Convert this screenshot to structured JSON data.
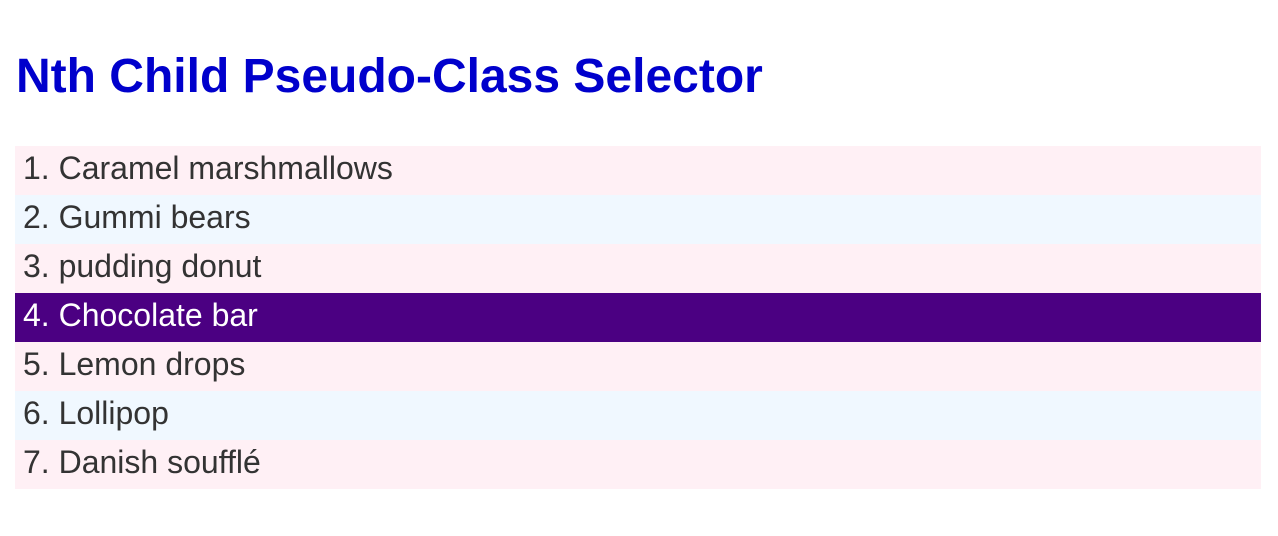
{
  "page": {
    "title": "Nth Child Pseudo-Class Selector"
  },
  "list": {
    "items": [
      {
        "number": "1.",
        "label": "Caramel marshmallows"
      },
      {
        "number": "2.",
        "label": "Gummi bears"
      },
      {
        "number": "3.",
        "label": "pudding donut"
      },
      {
        "number": "4.",
        "label": "Chocolate bar"
      },
      {
        "number": "5.",
        "label": "Lemon drops"
      },
      {
        "number": "6.",
        "label": "Lollipop"
      },
      {
        "number": "7.",
        "label": "Danish soufflé"
      }
    ]
  },
  "colors": {
    "title": "#0000cc",
    "odd_row": "#fff0f5",
    "even_row": "#f0f8ff",
    "highlight_row": "#4b0082",
    "highlight_text": "#ffffff",
    "text": "#333333"
  }
}
